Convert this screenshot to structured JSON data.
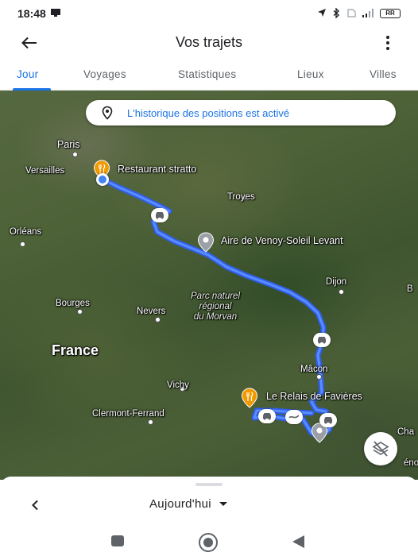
{
  "status_bar": {
    "time": "18:48",
    "battery": "RR"
  },
  "app_bar": {
    "title": "Vos trajets"
  },
  "tabs": [
    {
      "label": "Jour",
      "active": true
    },
    {
      "label": "Voyages",
      "active": false
    },
    {
      "label": "Statistiques",
      "active": false
    },
    {
      "label": "Lieux",
      "active": false
    },
    {
      "label": "Villes",
      "active": false
    }
  ],
  "map": {
    "history_notice": "L'historique des positions est activé",
    "labels": {
      "paris": "Paris",
      "versailles": "Versailles",
      "restaurant": "Restaurant stratto",
      "troyes": "Troyes",
      "orleans": "Orléans",
      "aire": "Aire de Venoy-Soleil Levant",
      "dijon": "Dijon",
      "bourges": "Bourges",
      "nevers": "Nevers",
      "park_line1": "Parc naturel",
      "park_line2": "régional",
      "park_line3": "du Morvan",
      "france": "France",
      "macon": "Mâcon",
      "vichy": "Vichy",
      "relais": "Le Relais de Favières",
      "clermont": "Clermont-Ferrand",
      "edge_b": "B",
      "edge_cha": "Cha",
      "edge_eno": "éno"
    },
    "icons": {
      "restaurant_pin": "restaurant-pin-icon",
      "aire_pin": "location-pin-icon",
      "relais_pin": "restaurant-pin-icon",
      "end_pin": "location-pin-icon",
      "layers": "layers-off-icon"
    },
    "route_color": "#3b6cf6"
  },
  "bottom_sheet": {
    "date_label": "Aujourd'hui"
  },
  "colors": {
    "accent": "#1a73e8",
    "restaurant_pin": "#f29900",
    "place_pin": "#9aa0a6"
  }
}
